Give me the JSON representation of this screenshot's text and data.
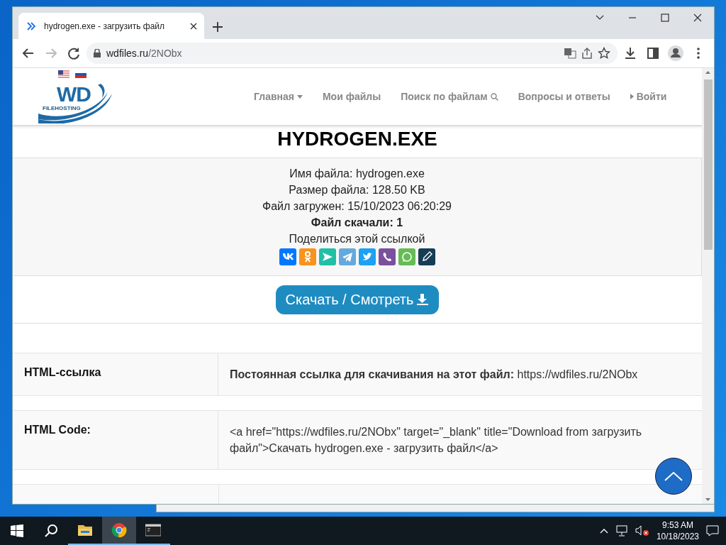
{
  "browser": {
    "tab": {
      "title": "hydrogen.exe - загрузить файл"
    },
    "address": {
      "host": "wdfiles.ru",
      "path": "/2NObx"
    }
  },
  "site": {
    "logo": {
      "mark": "WD",
      "caption": "FILEHOSTING"
    },
    "nav": [
      {
        "label": "Главная",
        "kind": "dropdown"
      },
      {
        "label": "Мои файлы",
        "kind": "plain"
      },
      {
        "label": "Поиск по файлам",
        "kind": "search"
      },
      {
        "label": "Вопросы и ответы",
        "kind": "plain"
      },
      {
        "label": "Войти",
        "kind": "login"
      }
    ]
  },
  "file": {
    "title": "HYDROGEN.EXE",
    "details": [
      {
        "label": "Имя файла:",
        "value": "hydrogen.exe"
      },
      {
        "label": "Размер файла:",
        "value": "128.50 KB"
      },
      {
        "label": "Файл загружен:",
        "value": "15/10/2023 06:20:29"
      }
    ],
    "downloads": "Файл скачали: 1",
    "share_label": "Поделиться этой ссылкой",
    "share_buttons": [
      {
        "kind": "vk",
        "color": "#0077ff"
      },
      {
        "kind": "ok",
        "color": "#f7931e"
      },
      {
        "kind": "send",
        "color": "#21c0a6"
      },
      {
        "kind": "telegram",
        "color": "#64a9dc"
      },
      {
        "kind": "twitter",
        "color": "#1da1f2"
      },
      {
        "kind": "viber",
        "color": "#7b519d"
      },
      {
        "kind": "whatsapp",
        "color": "#65bc54"
      },
      {
        "kind": "notes",
        "color": "#173d55"
      }
    ],
    "download_button": "Скачать / Смотреть"
  },
  "links": [
    {
      "label": "HTML-ссылка",
      "value": "**Постоянная ссылка для скачивания на этот файл:** https://wdfiles.ru/2NObx"
    },
    {
      "label": "HTML Code:",
      "value": "<a href=\"https://wdfiles.ru/2NObx\" target=\"_blank\" title=\"Download from загрузить файл\">Скачать hydrogen.exe - загрузить файл</a>"
    }
  ],
  "taskbar": {
    "apps": [
      {
        "kind": "explorer",
        "selected": false
      },
      {
        "kind": "chrome",
        "selected": true
      },
      {
        "kind": "terminal",
        "selected": false
      }
    ],
    "time": "9:53 AM",
    "date": "10/18/2023"
  }
}
